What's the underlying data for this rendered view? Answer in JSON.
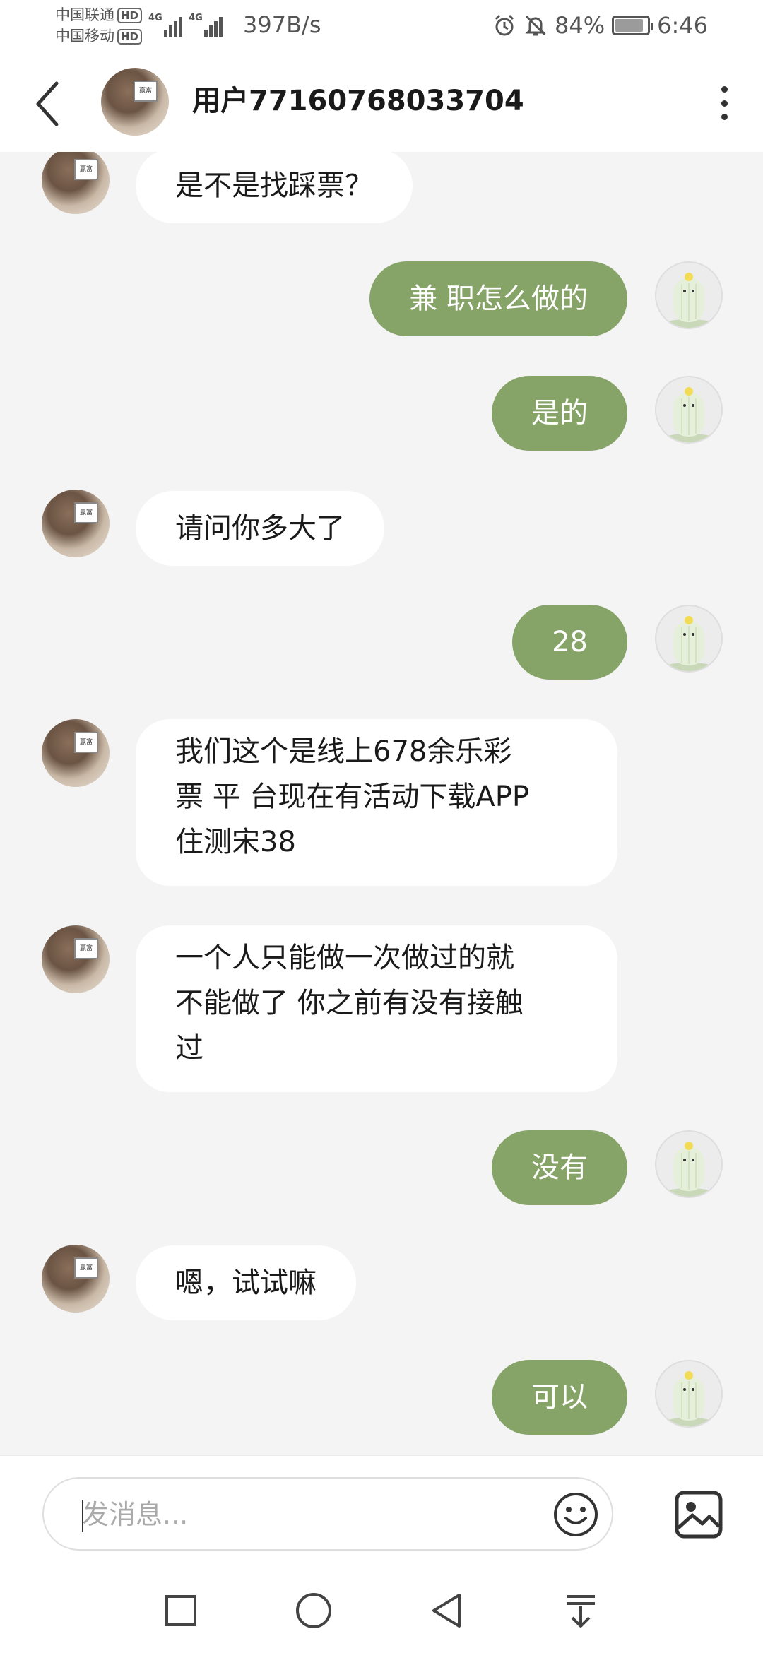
{
  "status_bar": {
    "carrier_1": "中国联通",
    "carrier_2": "中国移动",
    "hd_badge": "HD",
    "network_type": "4G",
    "net_speed": "397B/s",
    "battery": "84%",
    "time": "6:46",
    "icons": [
      "alarm-icon",
      "mute-icon",
      "battery-icon"
    ]
  },
  "header": {
    "title": "用户77160768033704",
    "back_icon": "back-chevron-icon",
    "more_icon": "more-vertical-icon"
  },
  "messages": [
    {
      "from": "other",
      "lines": [
        "是不是找踩票？"
      ]
    },
    {
      "from": "me",
      "lines": [
        "兼 职怎么做的"
      ]
    },
    {
      "from": "me",
      "lines": [
        "是的"
      ]
    },
    {
      "from": "other",
      "lines": [
        "请问你多大了"
      ]
    },
    {
      "from": "me",
      "lines": [
        "28"
      ]
    },
    {
      "from": "other",
      "lines": [
        "我们这个是线上678余乐彩",
        "票 平 台现在有活动下载APP",
        "住测宋38"
      ]
    },
    {
      "from": "other",
      "lines": [
        "一个人只能做一次做过的就",
        "不能做了 你之前有没有接触",
        "过"
      ]
    },
    {
      "from": "me",
      "lines": [
        "没有"
      ]
    },
    {
      "from": "other",
      "lines": [
        "嗯，试试嘛"
      ]
    },
    {
      "from": "me",
      "lines": [
        "可以"
      ]
    }
  ],
  "avatar_sign_text": "赢富",
  "input": {
    "placeholder": "发消息...",
    "emoji_icon": "emoji-icon",
    "image_icon": "image-icon"
  },
  "nav": {
    "icons": [
      "recents-square-icon",
      "home-circle-icon",
      "back-triangle-icon",
      "notification-pulldown-icon"
    ]
  },
  "colors": {
    "outgoing_bubble": "#87a468",
    "incoming_bubble": "#ffffff",
    "chat_background": "#f4f4f4"
  }
}
